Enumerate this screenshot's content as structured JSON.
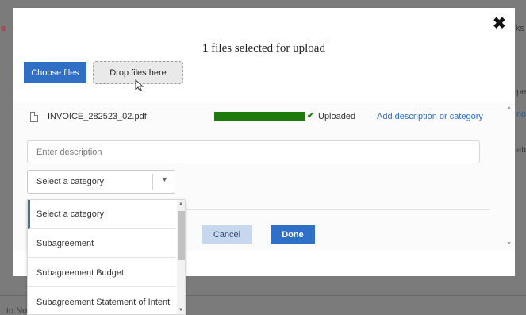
{
  "modal": {
    "close_glyph": "✖",
    "title_count": "1",
    "title_rest": " files selected for upload",
    "choose_files_label": "Choose files",
    "drop_files_label": "Drop files here"
  },
  "file": {
    "name": "INVOICE_282523_02.pdf",
    "progress_percent": 100,
    "status_icon": "✔",
    "status_label": "Uploaded",
    "add_description_link": "Add description or category",
    "description_placeholder": "Enter description",
    "category_selected": "Select a category"
  },
  "dropdown": {
    "options": [
      "Select a category",
      "Subagreement",
      "Subagreement Budget",
      "Subagreement Statement of Intent"
    ]
  },
  "actions": {
    "cancel_label": "Cancel",
    "done_label": "Done"
  },
  "background": {
    "frag_left_top": "s",
    "frag_right_top": "ks",
    "frag_right_mid1": "pen",
    "frag_right_mid2": "now",
    "frag_right_mid3": "ate",
    "frag_bottom_left": "to No"
  },
  "colors": {
    "primary": "#2f6fc6",
    "progress": "#1f7a0e",
    "overlay": "#7b7b7b"
  }
}
